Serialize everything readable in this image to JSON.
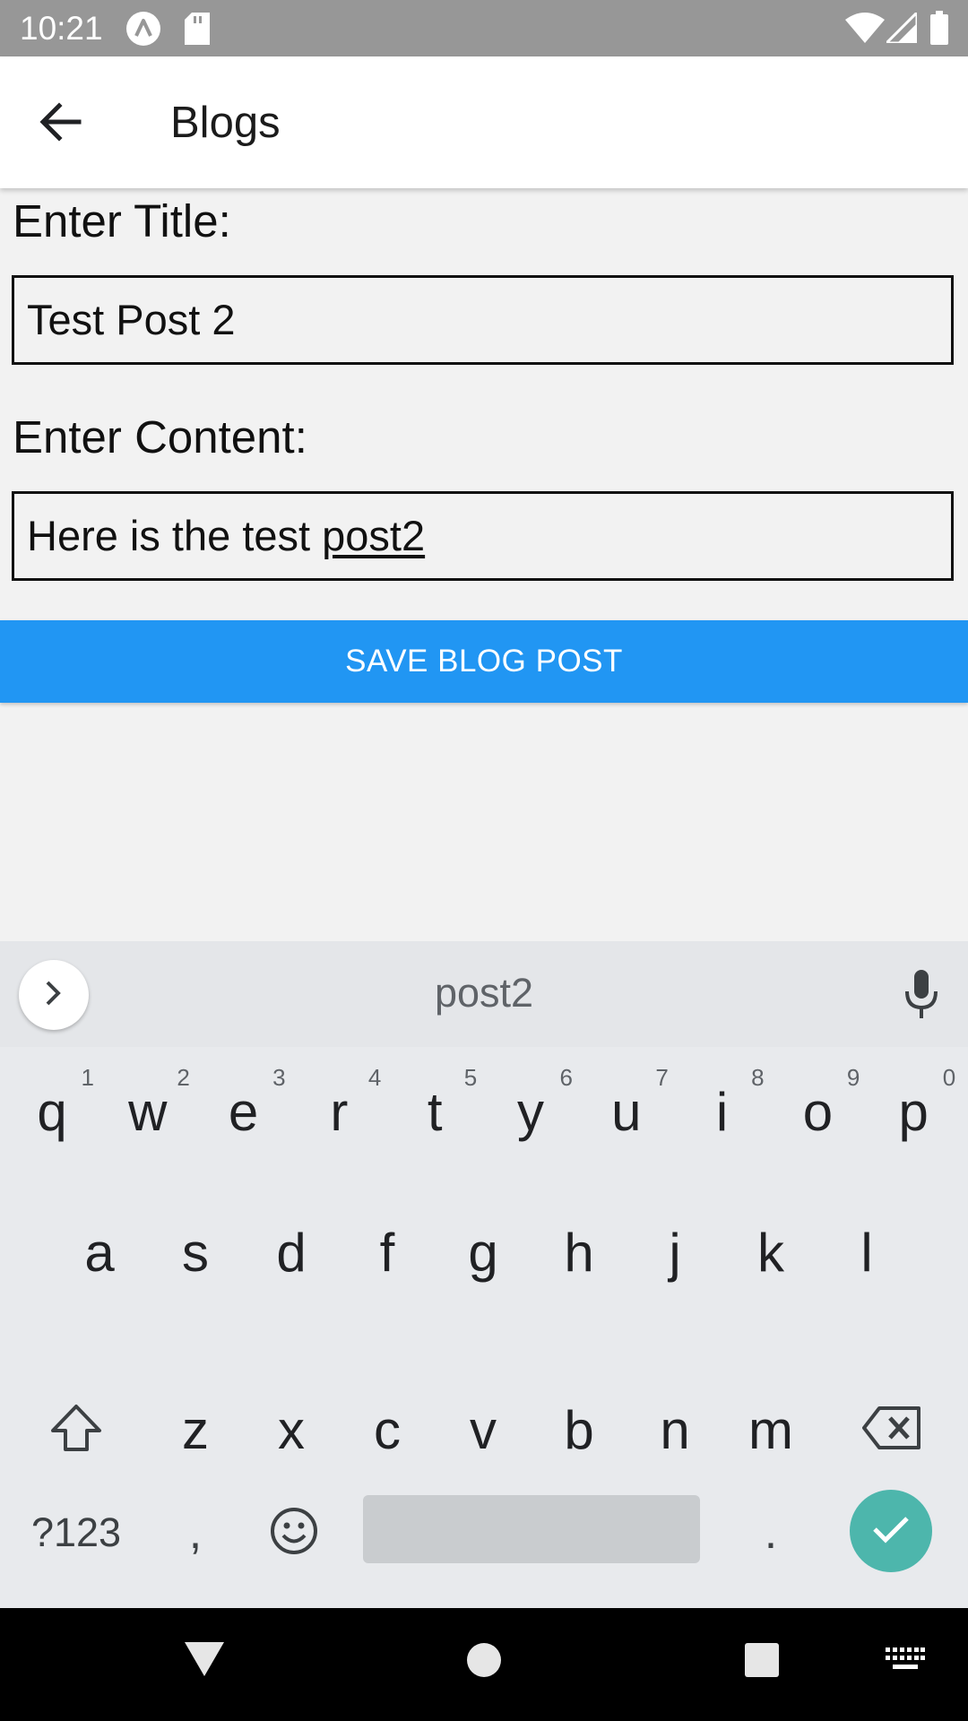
{
  "status_bar": {
    "time": "10:21",
    "icons": [
      "app-notification-icon",
      "sd-card-icon",
      "wifi-icon",
      "signal-icon",
      "battery-icon"
    ]
  },
  "app_bar": {
    "title": "Blogs",
    "back_icon": "arrow-back-icon"
  },
  "form": {
    "title_label": "Enter Title:",
    "title_value": "Test Post 2",
    "content_label": "Enter Content:",
    "content_value_prefix": "Here is the test ",
    "content_value_underlined": "post2",
    "save_label": "SAVE BLOG POST"
  },
  "keyboard": {
    "suggestion": "post2",
    "row1": [
      {
        "k": "q",
        "hint": "1"
      },
      {
        "k": "w",
        "hint": "2"
      },
      {
        "k": "e",
        "hint": "3"
      },
      {
        "k": "r",
        "hint": "4"
      },
      {
        "k": "t",
        "hint": "5"
      },
      {
        "k": "y",
        "hint": "6"
      },
      {
        "k": "u",
        "hint": "7"
      },
      {
        "k": "i",
        "hint": "8"
      },
      {
        "k": "o",
        "hint": "9"
      },
      {
        "k": "p",
        "hint": "0"
      }
    ],
    "row2": [
      "a",
      "s",
      "d",
      "f",
      "g",
      "h",
      "j",
      "k",
      "l"
    ],
    "row3": [
      "z",
      "x",
      "c",
      "v",
      "b",
      "n",
      "m"
    ],
    "symbols_label": "?123",
    "comma": ",",
    "period": "."
  },
  "colors": {
    "accent": "#2196f3",
    "enter_key": "#4db6ac",
    "status_bar": "#979797"
  }
}
